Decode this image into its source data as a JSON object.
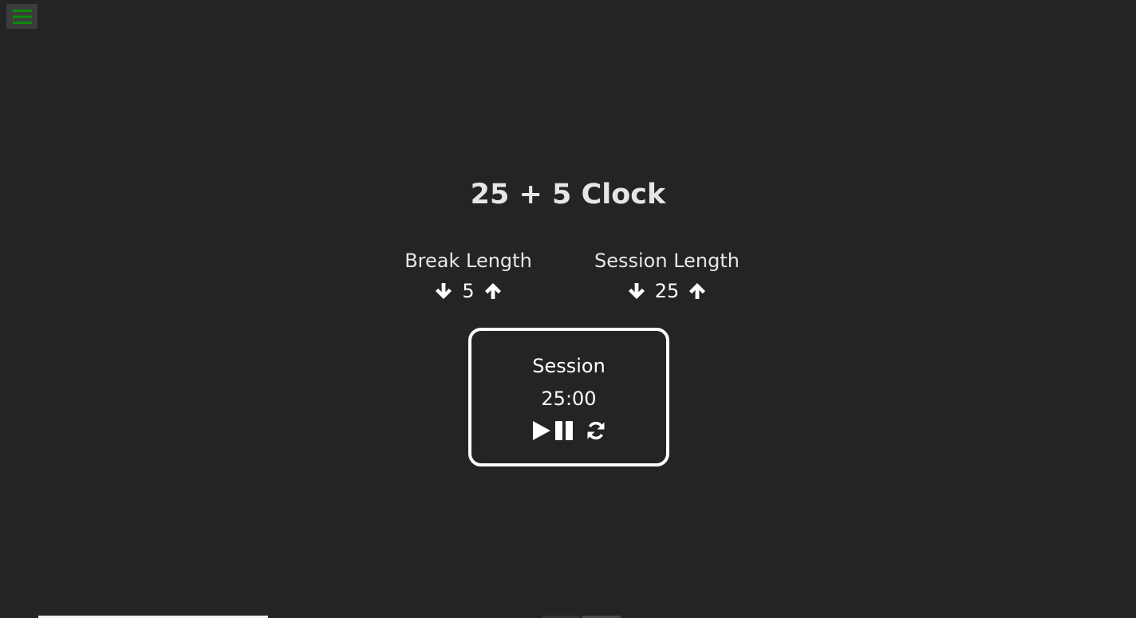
{
  "menu": {
    "icon": "hamburger-icon",
    "icon_color": "#0a8a0a"
  },
  "title": "25 + 5 Clock",
  "break": {
    "label": "Break Length",
    "value": "5",
    "decrement_icon": "arrow-down-icon",
    "increment_icon": "arrow-up-icon"
  },
  "session": {
    "label": "Session Length",
    "value": "25",
    "decrement_icon": "arrow-down-icon",
    "increment_icon": "arrow-up-icon"
  },
  "timer": {
    "label": "Session",
    "time_left": "25:00",
    "play_icon": "play-icon",
    "pause_icon": "pause-icon",
    "reset_icon": "refresh-icon"
  },
  "colors": {
    "background": "#242424",
    "text": "#ffffff",
    "accent": "#0a8a0a"
  }
}
